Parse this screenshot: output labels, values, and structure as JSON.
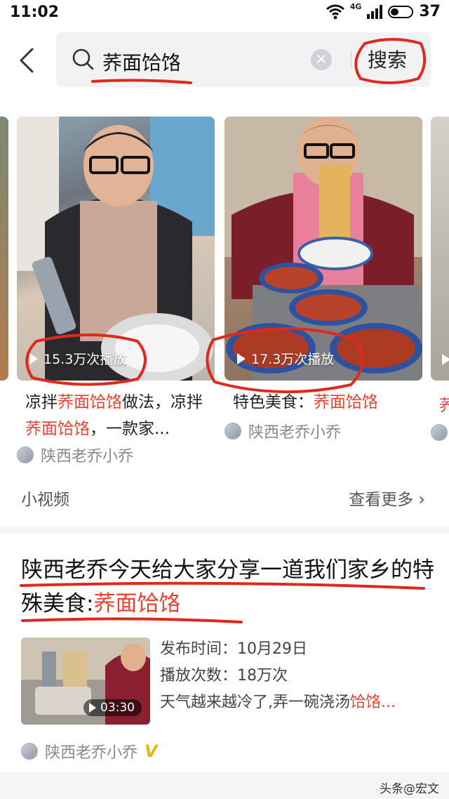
{
  "status_bar": {
    "time": "11:02",
    "network": "4G",
    "battery": "37"
  },
  "search": {
    "query": "荞面饸饹",
    "action_label": "搜索"
  },
  "videos": [
    {
      "plays": "15.3万次播放",
      "title_parts": [
        "凉拌",
        "荞面饸饹",
        "做法，凉拌",
        "荞面饸饹",
        "，一款家..."
      ],
      "author": "陕西老乔小乔"
    },
    {
      "plays": "17.3万次播放",
      "title_parts": [
        "特色美食：",
        "荞面饸饹"
      ],
      "author": "陕西老乔小乔"
    }
  ],
  "section": {
    "label": "小视频",
    "see_more": "查看更多"
  },
  "article": {
    "title_main": "陕西老乔今天给大家分享一道我们家乡的特殊美食:",
    "title_highlight": "荞面饸饹",
    "duration": "03:30",
    "publish": "发布时间：10月29日",
    "plays": "播放次数：18万次",
    "desc_main": "天气越来越冷了,弄一碗浇汤",
    "desc_highlight": "饸饹...",
    "author": "陕西老乔小乔",
    "verified": "V"
  },
  "watermark": "头条@宏文",
  "colors": {
    "highlight": "#e8412f",
    "annotation": "#e0281c"
  }
}
